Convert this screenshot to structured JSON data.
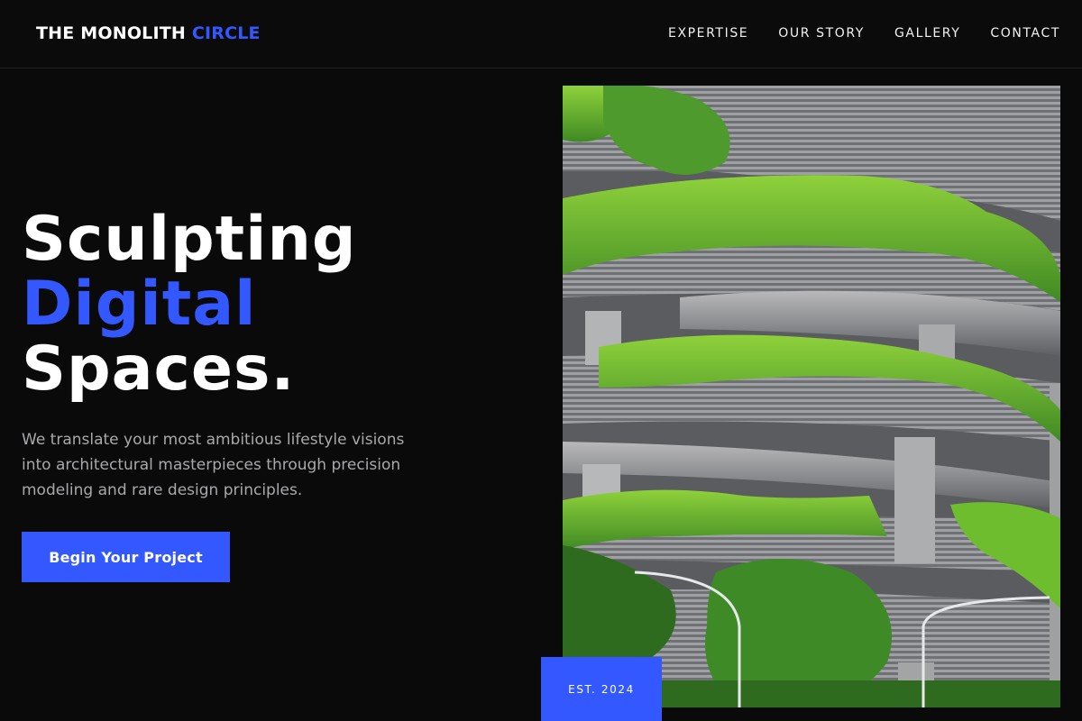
{
  "header": {
    "brand_main": "THE MONOLITH",
    "brand_accent": "CIRCLE",
    "nav": [
      "EXPERTISE",
      "OUR STORY",
      "GALLERY",
      "CONTACT"
    ]
  },
  "hero": {
    "title_line1": "Sculpting",
    "title_line2": "Digital",
    "title_line3": "Spaces.",
    "description": "We translate your most ambitious lifestyle visions into architectural masterpieces through precision modeling and rare design principles.",
    "cta_label": "Begin Your Project"
  },
  "image": {
    "alt": "Terraced building with hanging greenery",
    "badge": "EST. 2024"
  },
  "colors": {
    "background": "#0a0a0a",
    "accent": "#3358ff",
    "text": "#ffffff",
    "muted_text": "#a9a9ad"
  }
}
